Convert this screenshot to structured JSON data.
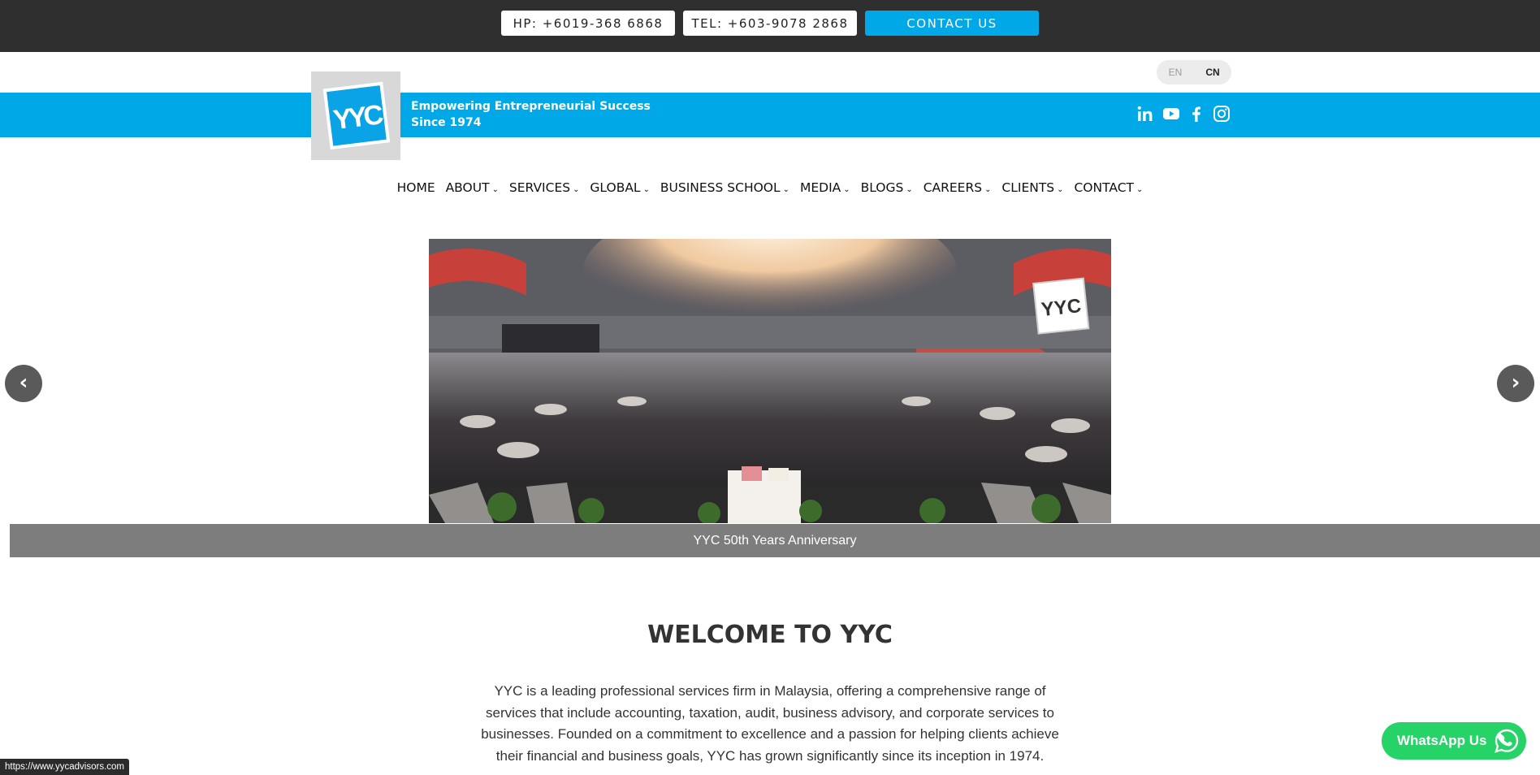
{
  "topbar": {
    "hp": "HP: +6019-368 6868",
    "tel": "TEL: +603-9078 2868",
    "contact": "CONTACT US"
  },
  "language": {
    "en": "EN",
    "cn": "CN"
  },
  "header": {
    "logo_text": "YYC",
    "tagline_line1": "Empowering Entrepreneurial Success",
    "tagline_line2": "Since 1974",
    "social": [
      "linkedin-icon",
      "youtube-icon",
      "facebook-icon",
      "instagram-icon"
    ]
  },
  "nav": {
    "items": [
      {
        "label": "HOME"
      },
      {
        "label": "ABOUT"
      },
      {
        "label": "SERVICES"
      },
      {
        "label": "GLOBAL"
      },
      {
        "label": "BUSINESS SCHOOL"
      },
      {
        "label": "MEDIA"
      },
      {
        "label": "BLOGS"
      },
      {
        "label": "CAREERS"
      },
      {
        "label": "CLIENTS"
      },
      {
        "label": "CONTACT"
      }
    ],
    "chevron": "⌄"
  },
  "slider": {
    "caption": "YYC 50th Years Anniversary",
    "prev": "‹",
    "next": "›",
    "screen_logo": "YYC"
  },
  "welcome": {
    "title": "WELCOME TO YYC",
    "body": "YYC is a leading professional services firm in Malaysia, offering a comprehensive range of services that include accounting, taxation, audit, business advisory, and corporate services to businesses. Founded on a commitment to excellence and a passion for helping clients achieve their financial and business goals, YYC has grown significantly since its inception in 1974."
  },
  "whatsapp": {
    "label": "WhatsApp Us"
  },
  "status_url": "https://www.yycadvisors.com",
  "colors": {
    "brand_blue": "#00a8e8",
    "topbar": "#2f2f2f",
    "whatsapp": "#25d366"
  }
}
